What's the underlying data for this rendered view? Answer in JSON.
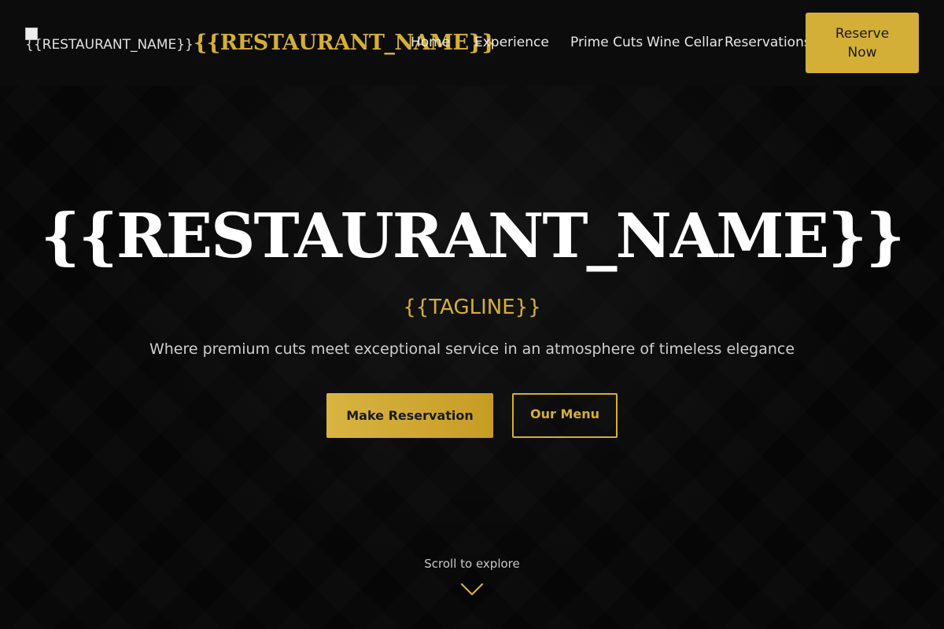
{
  "header": {
    "logo_alt": "{{RESTAURANT_NAME}}",
    "brand": "{{RESTAURANT_NAME}}",
    "nav": [
      {
        "label": "Home"
      },
      {
        "label": "Experience"
      },
      {
        "label": "Prime Cuts"
      },
      {
        "label": "Wine Cellar"
      },
      {
        "label": "Reservations"
      }
    ],
    "cta": "Reserve Now"
  },
  "hero": {
    "title": "{{RESTAURANT_NAME}}",
    "tagline": "{{TAGLINE}}",
    "subtitle": "Where premium cuts meet exceptional service in an atmosphere of timeless elegance",
    "primary_button": "Make Reservation",
    "secondary_button": "Our Menu"
  },
  "scroll": {
    "label": "Scroll to explore",
    "icon": "chevron-down-icon"
  },
  "colors": {
    "accent": "#d4af37",
    "background": "#060606",
    "header_bg": "#0c0c0c"
  }
}
